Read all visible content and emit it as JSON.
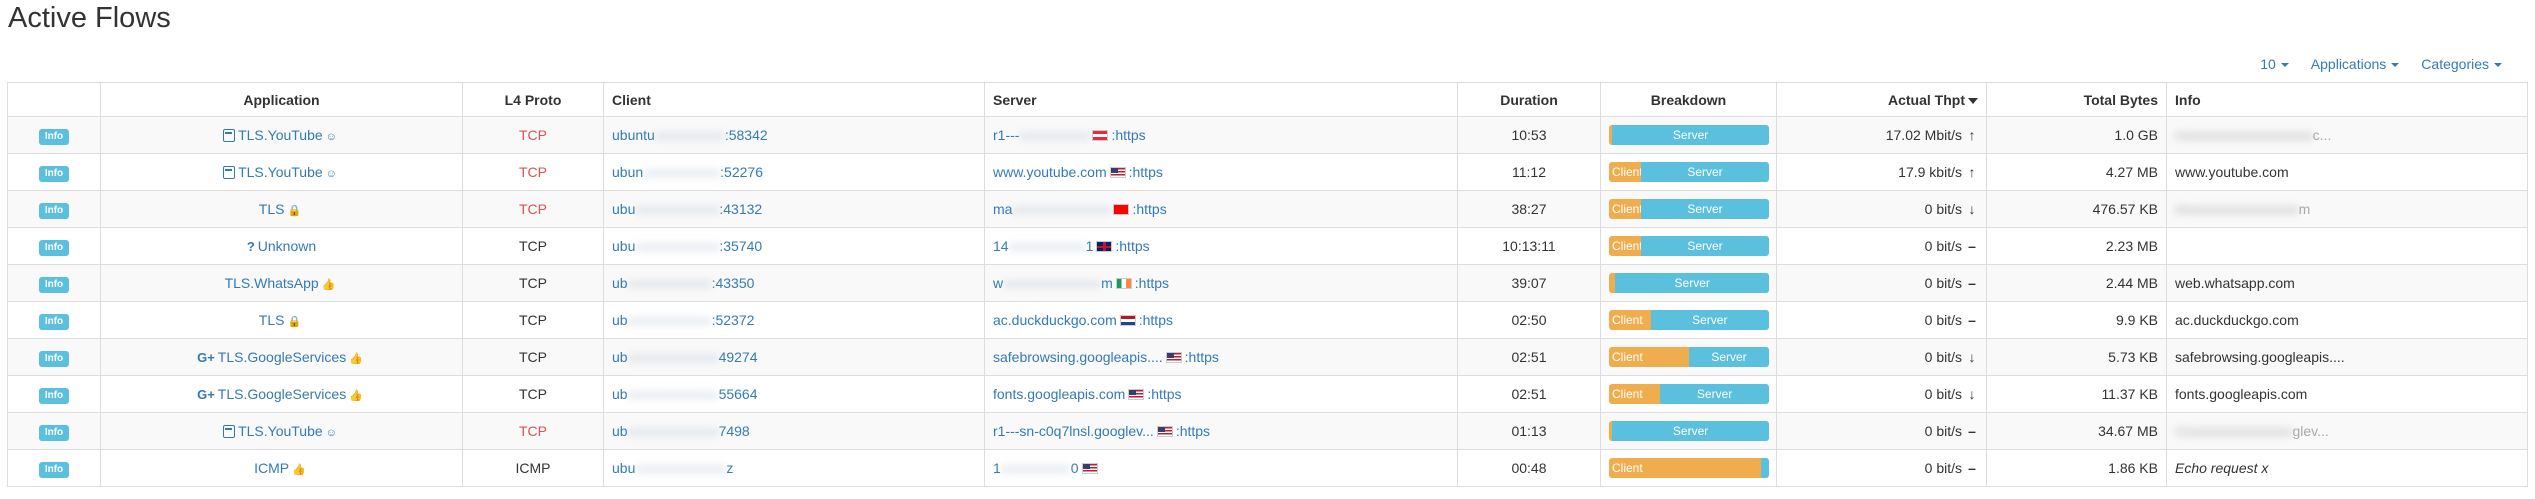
{
  "page": {
    "title": "Active Flows"
  },
  "toolbar": {
    "page_size": "10",
    "applications": "Applications",
    "categories": "Categories"
  },
  "columns": [
    "",
    "Application",
    "L4 Proto",
    "Client",
    "Server",
    "Duration",
    "Breakdown",
    "Actual Thpt",
    "Total Bytes",
    "Info"
  ],
  "breakdown_labels": {
    "client": "Client",
    "server": "Server"
  },
  "colors": {
    "client_bar": "#f0ad4e",
    "server_bar": "#5bc0de",
    "link": "#337ab7",
    "tcp_red": "#d9534f",
    "info_badge": "#5bc0de"
  },
  "rows": [
    {
      "info_btn": "Info",
      "app_icon": "youtube-icon",
      "app": "TLS.YouTube",
      "app_suffix_icon": "smile-icon",
      "proto": "TCP",
      "proto_red": true,
      "client_prefix": "ubuntu",
      "client_blur": "xxxxxxxxxx",
      "client_port": ":58342",
      "server_prefix": "r1---",
      "server_blur": "xxxxxxxxxx",
      "server_tail": "",
      "flag": "at",
      "server_port": ":https",
      "duration": "10:53",
      "client_pct": 2,
      "thpt": "17.02 Mbit/s",
      "thpt_icon": "arrow-up",
      "bytes": "1.0 GB",
      "info": "r",
      "info_blur": "xxxxxxxxxxxxxxxxxxx",
      "info_tail": "c...",
      "info_italic": false
    },
    {
      "info_btn": "Info",
      "app_icon": "youtube-icon",
      "app": "TLS.YouTube",
      "app_suffix_icon": "smile-icon",
      "proto": "TCP",
      "proto_red": true,
      "client_prefix": "ubun",
      "client_blur": "xxxxxxxxxxx",
      "client_port": ":52276",
      "server_prefix": "www.youtube.com",
      "server_blur": "",
      "server_tail": "",
      "flag": "us",
      "server_port": ":https",
      "duration": "11:12",
      "client_pct": 20,
      "thpt": "17.9 kbit/s",
      "thpt_icon": "arrow-up",
      "bytes": "4.27 MB",
      "info": "www.youtube.com",
      "info_blur": "",
      "info_tail": "",
      "info_italic": false
    },
    {
      "info_btn": "Info",
      "app_icon": "",
      "app": "TLS",
      "app_suffix_icon": "lock-icon",
      "proto": "TCP",
      "proto_red": true,
      "client_prefix": "ubu",
      "client_blur": "xxxxxxxxxxxx",
      "client_port": ":43132",
      "server_prefix": "ma",
      "server_blur": "xxxxxxxxxxxxxx",
      "server_tail": "",
      "flag": "ch",
      "server_port": ":https",
      "duration": "38:27",
      "client_pct": 20,
      "thpt": "0 bit/s",
      "thpt_icon": "arrow-down",
      "bytes": "476.57 KB",
      "info": "m",
      "info_blur": "xxxxxxxxxxxxxxxx",
      "info_tail": "m",
      "info_italic": false
    },
    {
      "info_btn": "Info",
      "app_icon": "question-icon",
      "app": "Unknown",
      "app_suffix_icon": "",
      "proto": "TCP",
      "proto_red": false,
      "client_prefix": "ubu",
      "client_blur": "xxxxxxxxxxxx",
      "client_port": ":35740",
      "server_prefix": "14",
      "server_blur": "xxxxxxxxxxx",
      "server_tail": "1",
      "flag": "gb",
      "server_port": ":https",
      "duration": "10:13:11",
      "client_pct": 20,
      "thpt": "0 bit/s",
      "thpt_icon": "dash",
      "bytes": "2.23 MB",
      "info": "",
      "info_blur": "",
      "info_tail": "",
      "info_italic": false
    },
    {
      "info_btn": "Info",
      "app_icon": "",
      "app": "TLS.WhatsApp",
      "app_suffix_icon": "thumbs-up-icon",
      "proto": "TCP",
      "proto_red": false,
      "client_prefix": "ub",
      "client_blur": "xxxxxxxxxxxx",
      "client_port": ":43350",
      "server_prefix": "w",
      "server_blur": "xxxxxxxxxxxxxx",
      "server_tail": "m",
      "flag": "ie",
      "server_port": ":https",
      "duration": "39:07",
      "client_pct": 4,
      "thpt": "0 bit/s",
      "thpt_icon": "dash",
      "bytes": "2.44 MB",
      "info": "web.whatsapp.com",
      "info_blur": "",
      "info_tail": "",
      "info_italic": false
    },
    {
      "info_btn": "Info",
      "app_icon": "",
      "app": "TLS",
      "app_suffix_icon": "lock-icon",
      "proto": "TCP",
      "proto_red": false,
      "client_prefix": "ub",
      "client_blur": "xxxxxxxxxxxx",
      "client_port": ":52372",
      "server_prefix": "ac.duckduckgo.com",
      "server_blur": "",
      "server_tail": "",
      "flag": "nl",
      "server_port": ":https",
      "duration": "02:50",
      "client_pct": 26,
      "thpt": "0 bit/s",
      "thpt_icon": "dash",
      "bytes": "9.9 KB",
      "info": "ac.duckduckgo.com",
      "info_blur": "",
      "info_tail": "",
      "info_italic": false
    },
    {
      "info_btn": "Info",
      "app_icon": "google-plus-icon",
      "app": "TLS.GoogleServices",
      "app_suffix_icon": "thumbs-up-icon",
      "proto": "TCP",
      "proto_red": false,
      "client_prefix": "ub",
      "client_blur": "xxxxxxxxxxxxx",
      "client_port": "49274",
      "server_prefix": "safebrowsing.googleapis....",
      "server_blur": "",
      "server_tail": "",
      "flag": "us",
      "server_port": ":https",
      "duration": "02:51",
      "client_pct": 50,
      "thpt": "0 bit/s",
      "thpt_icon": "arrow-down",
      "bytes": "5.73 KB",
      "info": "safebrowsing.googleapis....",
      "info_blur": "",
      "info_tail": "",
      "info_italic": false
    },
    {
      "info_btn": "Info",
      "app_icon": "google-plus-icon",
      "app": "TLS.GoogleServices",
      "app_suffix_icon": "thumbs-up-icon",
      "proto": "TCP",
      "proto_red": false,
      "client_prefix": "ub",
      "client_blur": "xxxxxxxxxxxxx",
      "client_port": "55664",
      "server_prefix": "fonts.googleapis.com",
      "server_blur": "",
      "server_tail": "",
      "flag": "us",
      "server_port": ":https",
      "duration": "02:51",
      "client_pct": 32,
      "thpt": "0 bit/s",
      "thpt_icon": "arrow-down",
      "bytes": "11.37 KB",
      "info": "fonts.googleapis.com",
      "info_blur": "",
      "info_tail": "",
      "info_italic": false
    },
    {
      "info_btn": "Info",
      "app_icon": "youtube-icon",
      "app": "TLS.YouTube",
      "app_suffix_icon": "smile-icon",
      "proto": "TCP",
      "proto_red": true,
      "client_prefix": "ub",
      "client_blur": "xxxxxxxxxxxxx",
      "client_port": "7498",
      "server_prefix": "r1---sn-c0q7lnsl.googlev...",
      "server_blur": "",
      "server_tail": "",
      "flag": "us",
      "server_port": ":https",
      "duration": "01:13",
      "client_pct": 2,
      "thpt": "0 bit/s",
      "thpt_icon": "dash",
      "bytes": "34.67 MB",
      "info": "r1",
      "info_blur": "xxxxxxxxxxxxxxx",
      "info_tail": "glev...",
      "info_italic": false
    },
    {
      "info_btn": "Info",
      "app_icon": "",
      "app": "ICMP",
      "app_suffix_icon": "thumbs-up-icon",
      "proto": "ICMP",
      "proto_red": false,
      "client_prefix": "ubu",
      "client_blur": "xxxxxxxxxxxxx",
      "client_port": "z",
      "server_prefix": "1",
      "server_blur": "xxxxxxxxxx",
      "server_tail": "0",
      "flag": "us",
      "server_port": "",
      "duration": "00:48",
      "client_pct": 95,
      "thpt": "0 bit/s",
      "thpt_icon": "dash",
      "bytes": "1.86 KB",
      "info": "Echo request x",
      "info_blur": "",
      "info_tail": "",
      "info_italic": true
    }
  ]
}
